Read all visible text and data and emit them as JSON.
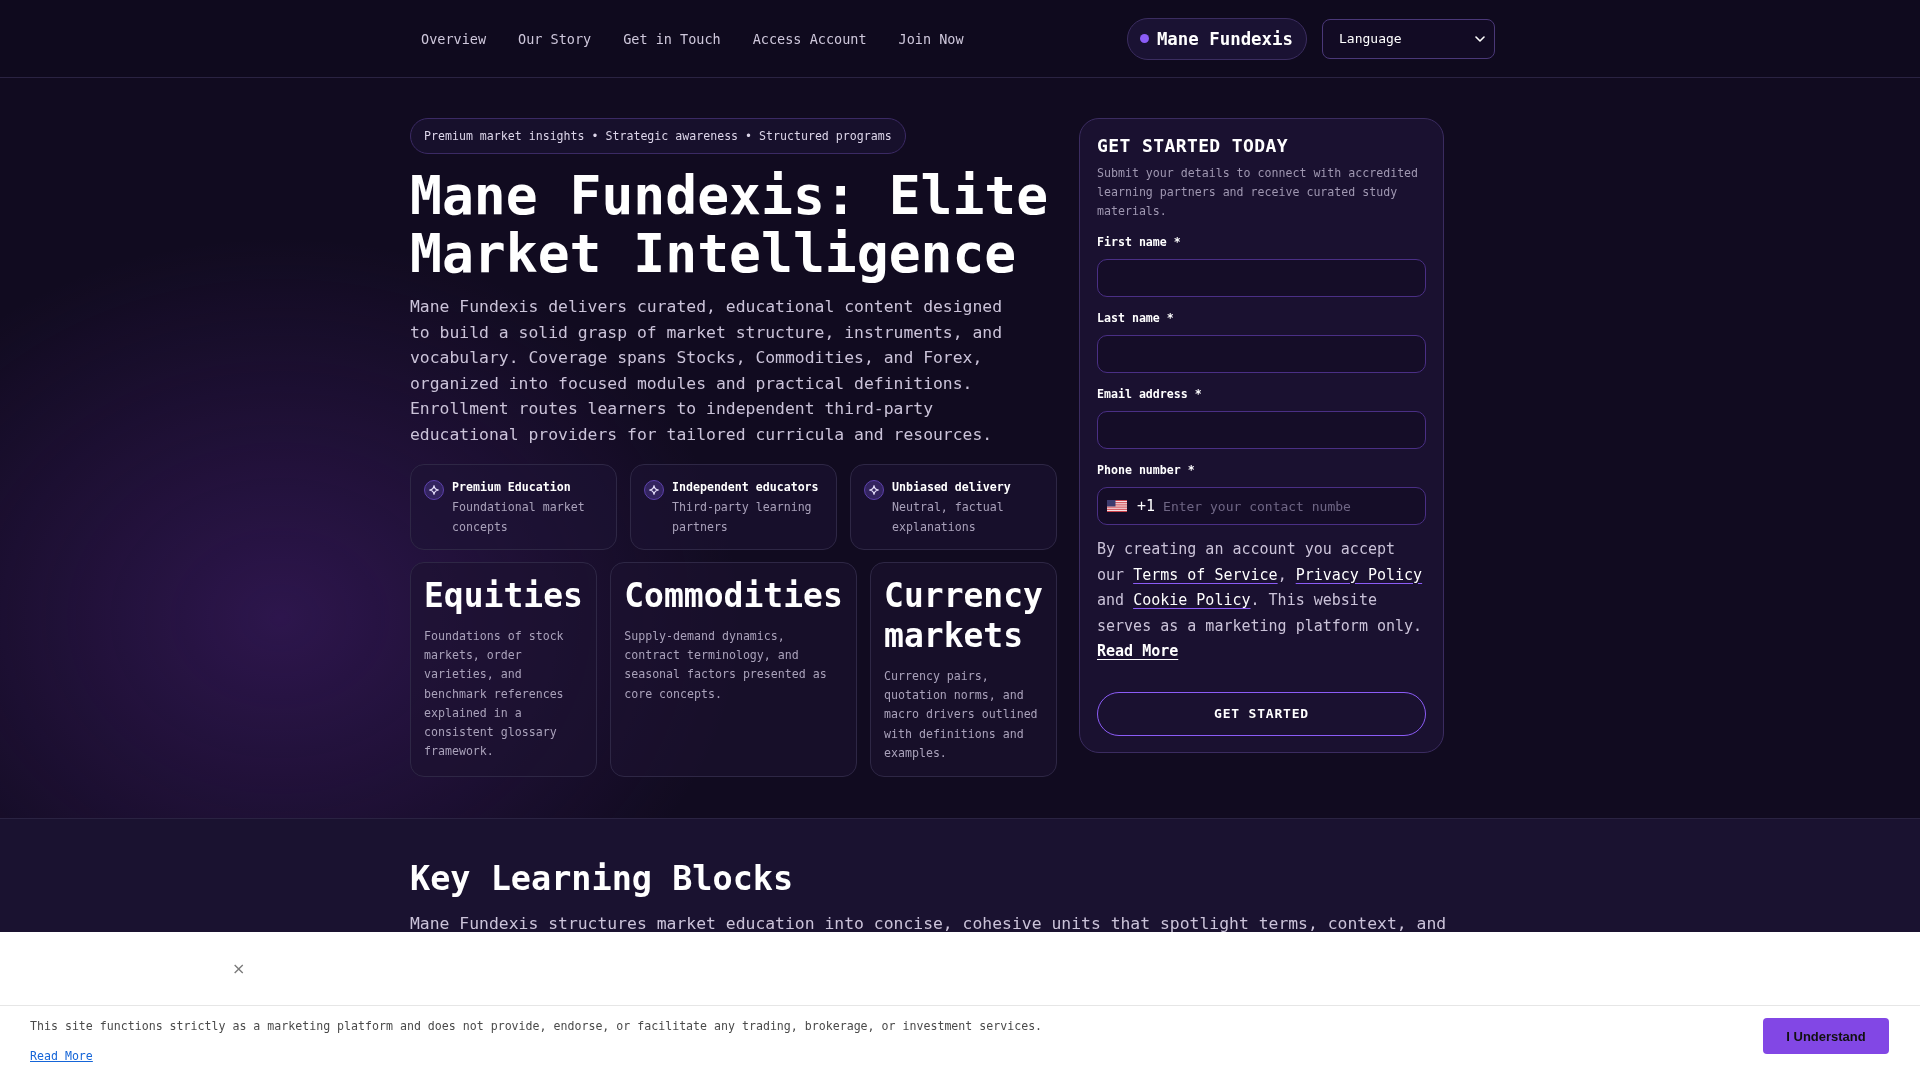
{
  "nav": {
    "links": [
      "Overview",
      "Our Story",
      "Get in Touch",
      "Access Account",
      "Join Now"
    ],
    "brand": "Mane Fundexis",
    "language_select": {
      "value": "Language"
    }
  },
  "hero": {
    "tagline": "Premium market insights • Strategic awareness • Structured programs",
    "title": "Mane Fundexis: Elite Market Intelligence",
    "description": "Mane Fundexis delivers curated, educational content designed to build a solid grasp of market structure, instruments, and vocabulary. Coverage spans Stocks, Commodities, and Forex, organized into focused modules and practical definitions. Enrollment routes learners to independent third-party educational providers for tailored curricula and resources.",
    "features": [
      {
        "title": "Premium Education",
        "description": "Foundational market concepts"
      },
      {
        "title": "Independent educators",
        "description": "Third-party learning partners"
      },
      {
        "title": "Unbiased delivery",
        "description": "Neutral, factual explanations"
      }
    ],
    "markets": [
      {
        "title": "Equities",
        "description": "Foundations of stock markets, order varieties, and benchmark references explained in a consistent glossary framework."
      },
      {
        "title": "Commodities",
        "description": "Supply-demand dynamics, contract terminology, and seasonal factors presented as core concepts."
      },
      {
        "title": "Currency markets",
        "description": "Currency pairs, quotation norms, and macro drivers outlined with definitions and examples."
      }
    ]
  },
  "signup_form": {
    "title": "GET STARTED TODAY",
    "subtitle": "Submit your details to connect with accredited learning partners and receive curated study materials.",
    "fields": [
      {
        "kind": "text",
        "label": "First name *"
      },
      {
        "kind": "text",
        "label": "Last name *"
      },
      {
        "kind": "email",
        "label": "Email address *"
      },
      {
        "kind": "phone",
        "label": "Phone number *",
        "country_code": "+1",
        "placeholder": "Enter your contact numbe"
      }
    ],
    "consent": [
      {
        "kind": "text",
        "text": "By creating an account you accept our "
      },
      {
        "kind": "link",
        "text": "Terms of Service"
      },
      {
        "kind": "text",
        "text": ", "
      },
      {
        "kind": "link",
        "text": "Privacy Policy"
      },
      {
        "kind": "text",
        "text": " and "
      },
      {
        "kind": "link",
        "text": "Cookie Policy"
      },
      {
        "kind": "text",
        "text": ". This website serves as a marketing platform only. "
      },
      {
        "kind": "strong_link",
        "text": "Read More"
      }
    ],
    "submit": "GET STARTED"
  },
  "learning_section": {
    "title": "Key Learning Blocks",
    "description": "Mane Fundexis structures market education into concise, cohesive units that spotlight terms, context, and"
  },
  "cookie_banner": {
    "close": "×",
    "text": "This site functions strictly as a marketing platform and does not provide, endorse, or facilitate any trading, brokerage, or investment services.",
    "link": "Read More",
    "button": "I Understand"
  }
}
